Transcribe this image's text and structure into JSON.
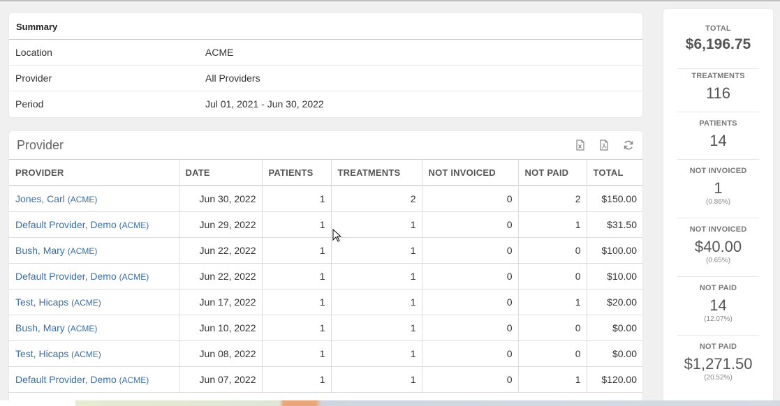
{
  "summary": {
    "title": "Summary",
    "rows": [
      {
        "key": "Location",
        "value": "ACME"
      },
      {
        "key": "Provider",
        "value": "All Providers"
      },
      {
        "key": "Period",
        "value": "Jul 01, 2021 - Jun 30, 2022"
      }
    ]
  },
  "provider": {
    "title": "Provider",
    "icons": [
      "excel-export-icon",
      "pdf-export-icon",
      "refresh-icon"
    ],
    "columns": [
      "PROVIDER",
      "DATE",
      "PATIENTS",
      "TREATMENTS",
      "NOT INVOICED",
      "NOT PAID",
      "TOTAL"
    ],
    "rows": [
      {
        "name": "Jones, Carl",
        "loc": "(ACME)",
        "date": "Jun 30, 2022",
        "patients": "1",
        "treatments": "2",
        "not_invoiced": "0",
        "not_paid": "2",
        "total": "$150.00"
      },
      {
        "name": "Default Provider, Demo",
        "loc": "(ACME)",
        "date": "Jun 29, 2022",
        "patients": "1",
        "treatments": "1",
        "not_invoiced": "0",
        "not_paid": "1",
        "total": "$31.50"
      },
      {
        "name": "Bush, Mary",
        "loc": "(ACME)",
        "date": "Jun 22, 2022",
        "patients": "1",
        "treatments": "1",
        "not_invoiced": "0",
        "not_paid": "0",
        "total": "$100.00"
      },
      {
        "name": "Default Provider, Demo",
        "loc": "(ACME)",
        "date": "Jun 22, 2022",
        "patients": "1",
        "treatments": "1",
        "not_invoiced": "0",
        "not_paid": "0",
        "total": "$10.00"
      },
      {
        "name": "Test, Hicaps",
        "loc": "(ACME)",
        "date": "Jun 17, 2022",
        "patients": "1",
        "treatments": "1",
        "not_invoiced": "0",
        "not_paid": "1",
        "total": "$20.00"
      },
      {
        "name": "Bush, Mary",
        "loc": "(ACME)",
        "date": "Jun 10, 2022",
        "patients": "1",
        "treatments": "1",
        "not_invoiced": "0",
        "not_paid": "0",
        "total": "$0.00"
      },
      {
        "name": "Test, Hicaps",
        "loc": "(ACME)",
        "date": "Jun 08, 2022",
        "patients": "1",
        "treatments": "1",
        "not_invoiced": "0",
        "not_paid": "0",
        "total": "$0.00"
      },
      {
        "name": "Default Provider, Demo",
        "loc": "(ACME)",
        "date": "Jun 07, 2022",
        "patients": "1",
        "treatments": "1",
        "not_invoiced": "0",
        "not_paid": "1",
        "total": "$120.00"
      }
    ]
  },
  "stats": [
    {
      "label": "TOTAL",
      "value": "$6,196.75",
      "pct": ""
    },
    {
      "label": "TREATMENTS",
      "value": "116",
      "pct": ""
    },
    {
      "label": "PATIENTS",
      "value": "14",
      "pct": ""
    },
    {
      "label": "NOT INVOICED",
      "value": "1",
      "pct": "(0.86%)"
    },
    {
      "label": "NOT INVOICED",
      "value": "$40.00",
      "pct": "(0.65%)"
    },
    {
      "label": "NOT PAID",
      "value": "14",
      "pct": "(12.07%)"
    },
    {
      "label": "NOT PAID",
      "value": "$1,271.50",
      "pct": "(20.52%)"
    }
  ],
  "colors": {
    "link": "#3a6fa5",
    "header_text": "#555555",
    "card_bg": "#ffffff",
    "page_bg": "#f0f0f0"
  }
}
